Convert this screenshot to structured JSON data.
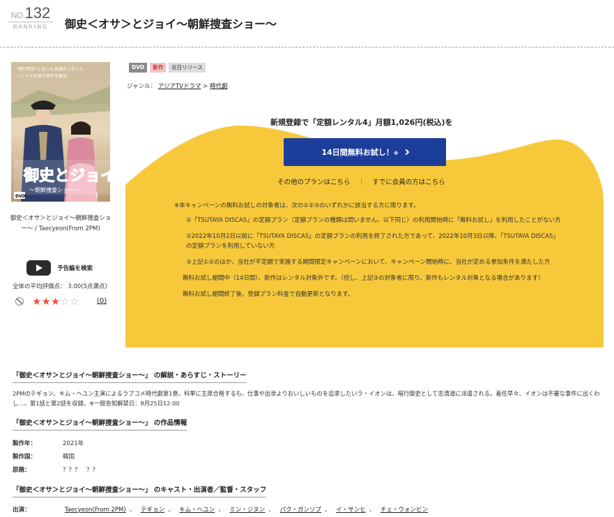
{
  "ranking": {
    "no_label": "NO.",
    "number": "132",
    "label": "RANKING"
  },
  "title": "御史＜オサ＞とジョイ〜朝鮮捜査ショー〜",
  "cover_caption": "御史＜オサ＞とジョイ〜朝鮮捜査ショー〜 / Taecyeon(From 2PM)",
  "trailer_label": "予告編を検索",
  "average_rating": "全体の平均評価点： 3.00(5点満点)",
  "rating": {
    "stars": 3,
    "max": 5,
    "count": "(0)"
  },
  "tags": {
    "dvd": "DVD",
    "new": "新作",
    "recent": "近日リリース"
  },
  "genre": {
    "label": "ジャンル：",
    "items": [
      "アジアTVドラマ",
      "時代劇"
    ],
    "sep": ">"
  },
  "campaign": {
    "headline": "新規登録で「定額レンタル4」月額1,026円(税込)を",
    "cta": "14日間無料お試し！",
    "cta_mark": "※",
    "other_plans": "その他のプランはこちら",
    "member_link": "すでに会員の方はこちら",
    "sep": "｜",
    "note_lead": "※本キャンペーンの無料お試しの対象者は、次の①②③のいずれかに該当する方に限ります。",
    "conditions": [
      "①「TSUTAYA DISCAS」の定額プラン（定額プランの種類は問いません。以下同じ）の利用開始時に「無料お試し」を利用したことがない方",
      "②2022年10月2日以前に「TSUTAYA DISCAS」の定額プランの利用を終了された方であって、2022年10月3日以降、「TSUTAYA DISCAS」の定額プランを利用していない方",
      "③上記①②のほか、当社が不定期で実施する期間限定キャンペーンにおいて、キャンペーン開始時に、当社が定める参加条件を満たした方"
    ],
    "note_period": "無料お試し期間中（14日間）、新作はレンタル対象外です。（但し、上記③の対象者に限り、新作もレンタル対象となる場合があります）",
    "note_renew": "無料お試し期間終了後、登録プラン料金で自動更新となります。"
  },
  "sections": {
    "synopsis_title": "「御史＜オサ＞とジョイ〜朝鮮捜査ショー〜」 の解説・あらすじ・ストーリー",
    "synopsis": "2PMのテギョン、キム・ヘユン主演によるラブコメ時代劇第1巻。科挙に主席合格するも、仕事や出世よりおいしいものを追求したいラ・イオンは、暗行御史として忠清道に派遣される。着任早々、イオンは不審な事件に出くわし…。第1話と第2話を収録。※一般告知解禁日：8月25日12:00",
    "info_title": "「御史＜オサ＞とジョイ〜朝鮮捜査ショー〜」 の作品情報",
    "info": [
      {
        "key": "製作年：",
        "value": "2021年"
      },
      {
        "key": "製作国：",
        "value": "韓国"
      },
      {
        "key": "原題：",
        "value": "？？？　？？"
      }
    ],
    "cast_title": "「御史＜オサ＞とジョイ〜朝鮮捜査ショー〜」 のキャスト・出演者／監督・スタッフ",
    "cast_label": "出演：",
    "cast": [
      "Taecyeon(From 2PM)",
      "テギョン",
      "キム・ヘユン",
      "ミン・ジヌン",
      "パク・ガンソプ",
      "イ・サンヒ",
      "チェ・ウォンビン"
    ],
    "cast_sep": "、"
  },
  "colors": {
    "accent_yellow": "#f7c93a",
    "cta_blue": "#1c3e9a",
    "star": "#e8583c"
  },
  "icons": {
    "trailer": "youtube-play-icon",
    "no_rating": "ban-icon",
    "cta": "chevron-right-icon"
  }
}
